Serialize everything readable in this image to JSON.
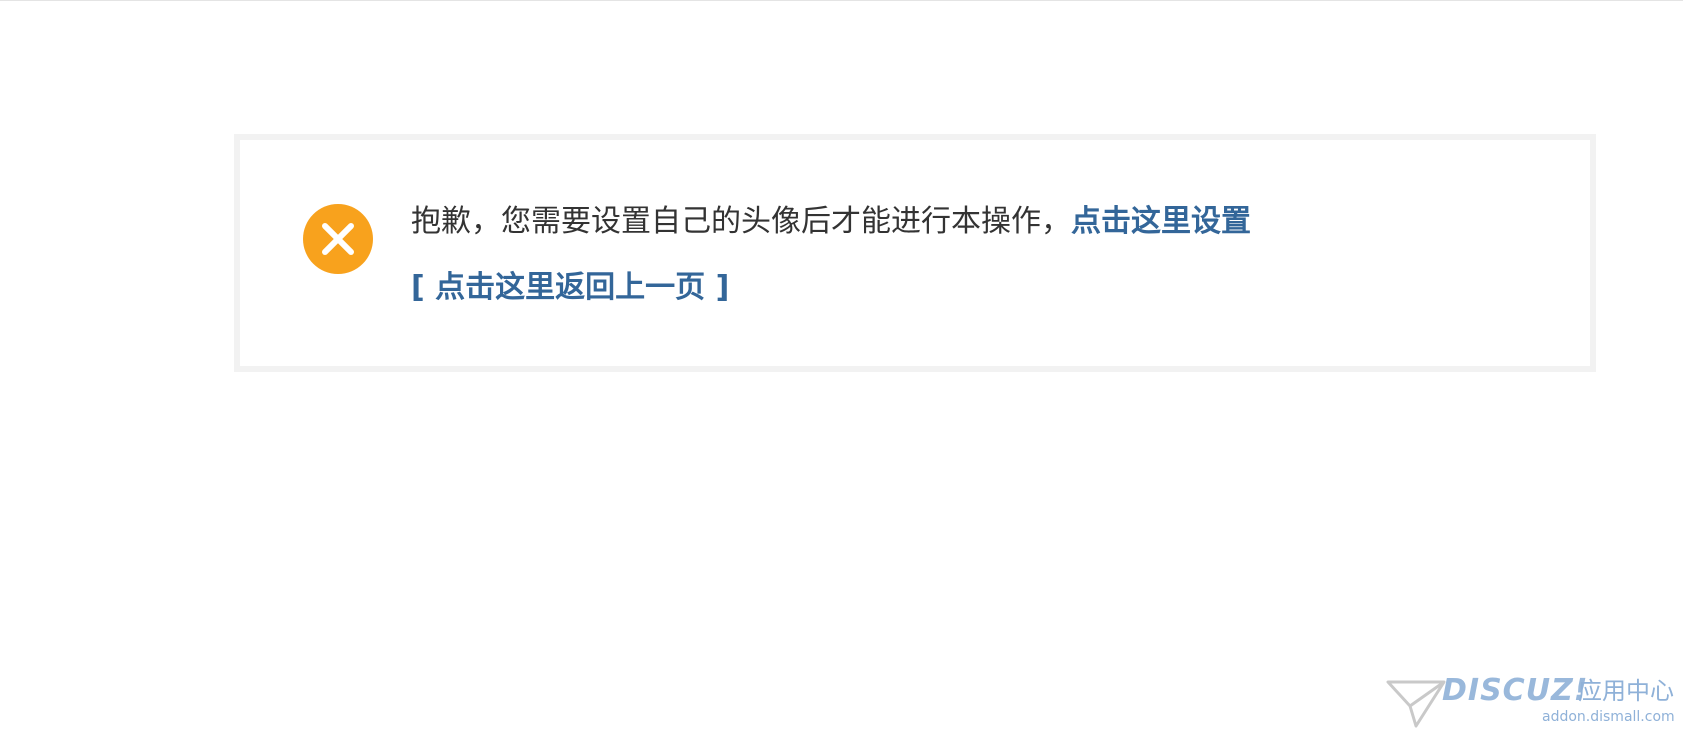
{
  "colors": {
    "warning": "#f8a21d",
    "link": "#336699",
    "text": "#333333",
    "box_border": "#f2f2f2",
    "watermark": "#8fb1d8"
  },
  "message": {
    "icon": "close-icon",
    "text": "抱歉，您需要设置自己的头像后才能进行本操作，",
    "action_link": "点击这里设置",
    "back_link": "[ 点击这里返回上一页 ]"
  },
  "watermark": {
    "icon": "paper-plane-icon",
    "brand": "DISCUZ!",
    "subtitle": "应用中心",
    "url": "addon.dismall.com"
  }
}
